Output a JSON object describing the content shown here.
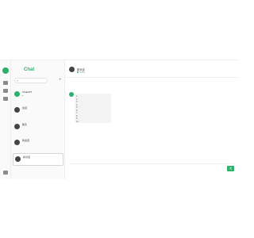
{
  "app": {
    "brand": "Chat"
  },
  "colors": {
    "accent": "#2eaf6a"
  },
  "sidebar_rail": {
    "items": [
      {
        "icon": "chat-bubble-icon"
      },
      {
        "icon": "grid-icon"
      },
      {
        "icon": "user-icon"
      },
      {
        "icon": "settings-icon"
      }
    ]
  },
  "search": {
    "placeholder": ""
  },
  "conversations": [
    {
      "title": "ChatGPT",
      "subtitle": "●",
      "time": "",
      "avatar": "green"
    },
    {
      "title": "会话",
      "subtitle": "",
      "time": "",
      "avatar": "dark"
    },
    {
      "title": "聊天",
      "subtitle": "",
      "time": "",
      "avatar": "dark"
    },
    {
      "title": "新会话",
      "subtitle": "",
      "time": "",
      "avatar": "dark"
    },
    {
      "title": "新对话",
      "subtitle": "",
      "time": "",
      "avatar": "dark",
      "active": true
    }
  ],
  "main": {
    "title": "新对话",
    "status": "Online",
    "sent_time": "",
    "sent_text": "",
    "bot_lines": [
      "1.",
      "2.",
      "3.",
      "4.",
      "5.",
      "6.",
      "7.",
      "8.",
      "9.",
      "10."
    ],
    "watermark": "",
    "input_placeholder": "",
    "send_label": "发"
  }
}
